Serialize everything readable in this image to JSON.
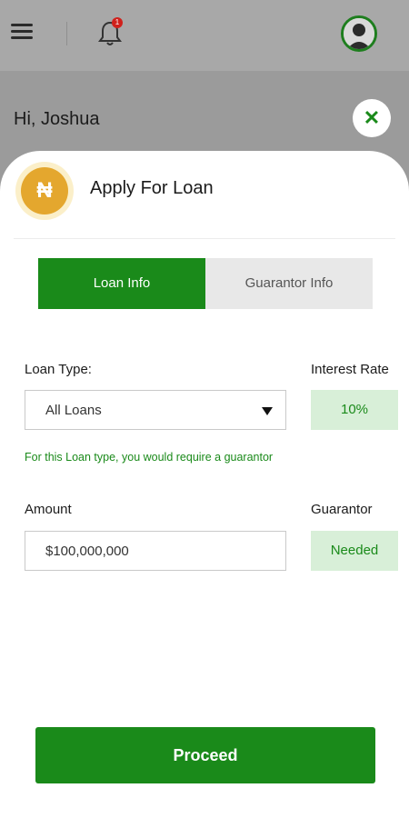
{
  "header": {
    "notification_count": "1",
    "icons": [
      "menu-icon",
      "bell-icon",
      "avatar"
    ]
  },
  "greeting": "Hi, Joshua",
  "sheet": {
    "title": "Apply For Loan",
    "currency_symbol": "₦",
    "close_symbol": "✕"
  },
  "tabs": [
    {
      "label": "Loan Info",
      "active": true
    },
    {
      "label": "Guarantor Info",
      "active": false
    }
  ],
  "form": {
    "loan_type_label": "Loan Type:",
    "loan_type_value": "All Loans",
    "interest_rate_label": "Interest Rate",
    "interest_rate_value": "10%",
    "guarantor_note": "For this Loan type, you would require a guarantor",
    "amount_label": "Amount",
    "amount_value": "$100,000,000",
    "guarantor_label": "Guarantor",
    "guarantor_value": "Needed"
  },
  "actions": {
    "proceed_label": "Proceed"
  },
  "colors": {
    "primary_green": "#1a8a1a",
    "light_green": "#d8efd8",
    "naira_gold": "#e4a72e",
    "badge_red": "#d0211c"
  }
}
